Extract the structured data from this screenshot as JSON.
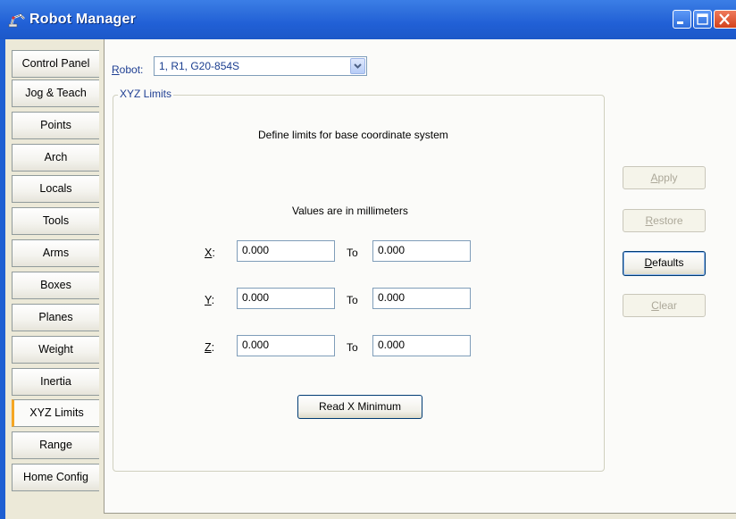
{
  "window": {
    "title": "Robot Manager",
    "icon": "robot-arm-icon",
    "controls": [
      "minimize-icon",
      "maximize-icon",
      "close-icon"
    ]
  },
  "tabs": [
    {
      "label": "Control Panel",
      "active": false
    },
    {
      "label": "Jog & Teach",
      "active": false
    },
    {
      "label": "Points",
      "active": false
    },
    {
      "label": "Arch",
      "active": false
    },
    {
      "label": "Locals",
      "active": false
    },
    {
      "label": "Tools",
      "active": false
    },
    {
      "label": "Arms",
      "active": false
    },
    {
      "label": "Boxes",
      "active": false
    },
    {
      "label": "Planes",
      "active": false
    },
    {
      "label": "Weight",
      "active": false
    },
    {
      "label": "Inertia",
      "active": false
    },
    {
      "label": "XYZ Limits",
      "active": true
    },
    {
      "label": "Range",
      "active": false
    },
    {
      "label": "Home Config",
      "active": false
    }
  ],
  "robot": {
    "label_mnemonic": "R",
    "label_rest": "obot:",
    "selected": "1, R1, G20-854S"
  },
  "group": {
    "title": "XYZ Limits",
    "description": "Define limits for base coordinate system",
    "units_note": "Values are in millimeters",
    "to_label": "To",
    "rows": [
      {
        "axis_mnemonic": "X",
        "axis_rest": ":",
        "min": "0.000",
        "max": "0.000"
      },
      {
        "axis_mnemonic": "Y",
        "axis_rest": ":",
        "min": "0.000",
        "max": "0.000"
      },
      {
        "axis_mnemonic": "Z",
        "axis_rest": ":",
        "min": "0.000",
        "max": "0.000"
      }
    ],
    "read_button": "Read X Minimum"
  },
  "actions": {
    "apply": {
      "mnemonic": "A",
      "rest": "pply",
      "enabled": false
    },
    "restore": {
      "mnemonic": "R",
      "rest": "estore",
      "enabled": false
    },
    "defaults": {
      "mnemonic": "D",
      "rest": "efaults",
      "enabled": true
    },
    "clear": {
      "mnemonic": "C",
      "rest": "lear",
      "enabled": false
    }
  },
  "colors": {
    "titlebar": "#2160d6",
    "active_tab_accent": "#f5a623",
    "group_title": "#1f3f93"
  }
}
